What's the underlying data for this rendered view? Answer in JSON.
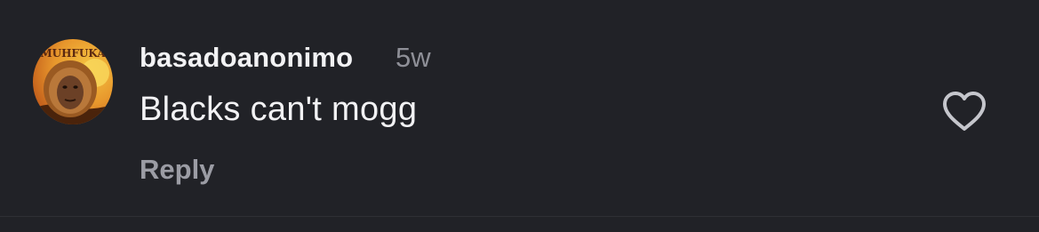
{
  "comment": {
    "username": "basadoanonimo",
    "time": "5w",
    "text": "Blacks can't mogg",
    "reply_label": "Reply",
    "avatar_text": "MUHFUKA",
    "like_icon": "heart-outline-icon"
  },
  "colors": {
    "background": "#212227",
    "text_primary": "#f2f2f4",
    "text_secondary": "#8e8f97",
    "reply": "#9b9ca4",
    "icon": "#c5c6cc"
  }
}
